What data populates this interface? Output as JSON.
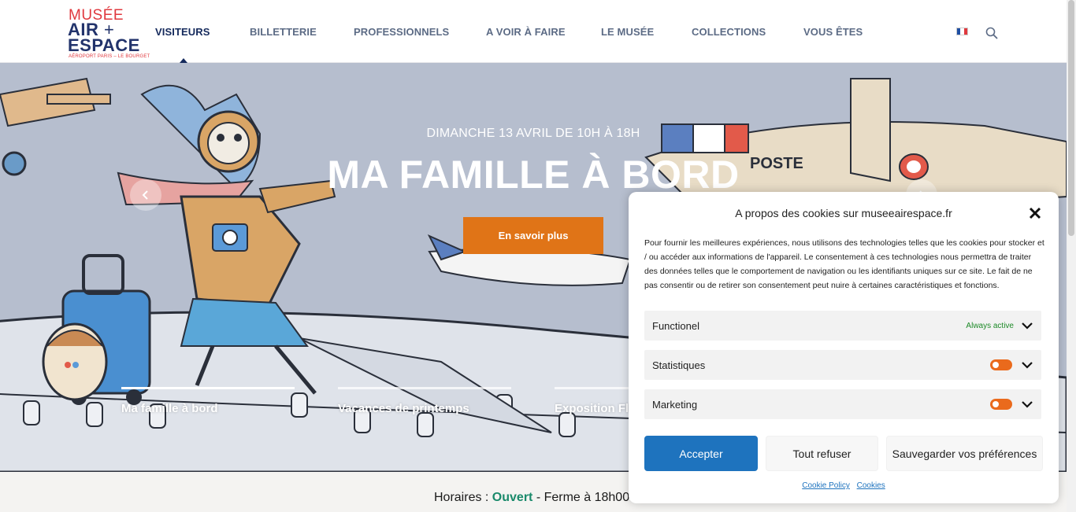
{
  "logo": {
    "line1": "MUSÉE",
    "line2": "AIR",
    "plus": "+",
    "line3": "ESPACE",
    "tagline": "AÉROPORT PARIS – LE BOURGET"
  },
  "nav": {
    "items": [
      {
        "label": "VISITEURS",
        "active": true
      },
      {
        "label": "BILLETTERIE"
      },
      {
        "label": "PROFESSIONNELS"
      },
      {
        "label": "A VOIR À FAIRE"
      },
      {
        "label": "LE MUSÉE"
      },
      {
        "label": "COLLECTIONS"
      },
      {
        "label": "VOUS ÊTES"
      }
    ],
    "language_icon": "french-flag-icon",
    "search_icon": "search-icon"
  },
  "hero": {
    "date": "DIMANCHE 13 AVRIL DE 10H À 18H",
    "title": "MA FAMILLE À BORD",
    "cta": "En savoir plus",
    "plane_text": "POSTE",
    "slides": [
      "Ma famille à bord",
      "Vacances de printemps",
      "Exposition Fli"
    ]
  },
  "status": {
    "label": "Horaires : ",
    "state": "Ouvert",
    "detail": " - Ferme à 18h00"
  },
  "cookie": {
    "title": "A propos des cookies sur museeairespace.fr",
    "text": "Pour fournir les meilleures expériences, nous utilisons des technologies telles que les cookies pour stocker et / ou accéder aux informations de l'appareil. Le consentement à ces technologies nous permettra de traiter des données telles que le comportement de navigation ou les identifiants uniques sur ce site. Le fait de ne pas consentir ou de retirer son consentement peut nuire à certaines caractéristiques et fonctions.",
    "categories": [
      {
        "name": "Functionel",
        "status": "Always active"
      },
      {
        "name": "Statistiques"
      },
      {
        "name": "Marketing"
      }
    ],
    "accept": "Accepter",
    "refuse": "Tout refuser",
    "save": "Sauvegarder vos préférences",
    "links": [
      "Cookie Policy",
      "Cookies"
    ]
  },
  "colors": {
    "brand_navy": "#22336b",
    "brand_red": "#e0383e",
    "cta_orange": "#e07417",
    "accept_blue": "#1e73be",
    "toggle_orange": "#ea6a1c",
    "open_green": "#1a8a6b"
  }
}
